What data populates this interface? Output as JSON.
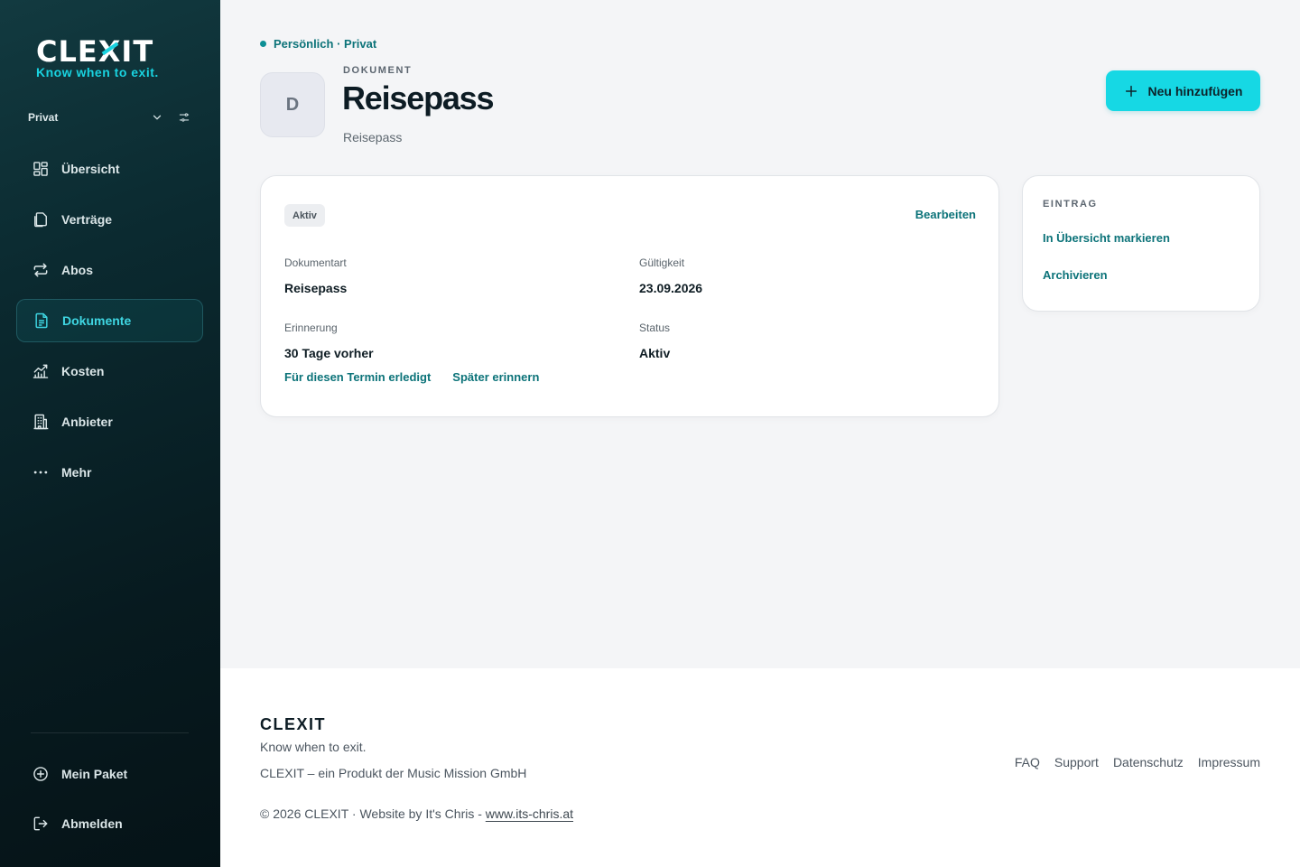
{
  "brand": {
    "name_prefix": "CLE",
    "name_x": "X",
    "name_suffix": "IT",
    "tagline": "Know when to exit.",
    "accent_color": "#16d8e4"
  },
  "sidebar": {
    "workspace": "Privat",
    "items": [
      {
        "label": "Übersicht",
        "icon": "dashboard-icon"
      },
      {
        "label": "Verträge",
        "icon": "documents-copy-icon"
      },
      {
        "label": "Abos",
        "icon": "repeat-icon"
      },
      {
        "label": "Dokumente",
        "icon": "document-text-icon",
        "active": true
      },
      {
        "label": "Kosten",
        "icon": "chart-icon"
      },
      {
        "label": "Anbieter",
        "icon": "building-icon"
      },
      {
        "label": "Mehr",
        "icon": "more-dots-icon"
      }
    ],
    "bottom_items": [
      {
        "label": "Mein Paket",
        "icon": "plus-circle-icon"
      },
      {
        "label": "Abmelden",
        "icon": "logout-icon"
      }
    ]
  },
  "header": {
    "breadcrumb": "Persönlich · Privat",
    "avatar_letter": "D",
    "kicker": "DOKUMENT",
    "title": "Reisepass",
    "subtitle": "Reisepass",
    "add_button": "Neu hinzufügen"
  },
  "detail_card": {
    "badge": "Aktiv",
    "edit_label": "Bearbeiten",
    "fields": {
      "type_label": "Dokumentart",
      "type_value": "Reisepass",
      "validity_label": "Gültigkeit",
      "validity_value": "23.09.2026",
      "reminder_label": "Erinnerung",
      "reminder_value": "30 Tage vorher",
      "status_label": "Status",
      "status_value": "Aktiv"
    },
    "action_done": "Für diesen Termin erledigt",
    "action_later": "Später erinnern"
  },
  "entry_card": {
    "kicker": "EINTRAG",
    "mark_label": "In Übersicht markieren",
    "archive_label": "Archivieren"
  },
  "footer": {
    "brand": "CLEXIT",
    "tagline": "Know when to exit.",
    "company": "CLEXIT – ein Produkt der Music Mission GmbH",
    "copyright": "© 2026 CLEXIT · Website by It's Chris - ",
    "website": "www.its-chris.at",
    "links": [
      "FAQ",
      "Support",
      "Datenschutz",
      "Impressum"
    ]
  }
}
